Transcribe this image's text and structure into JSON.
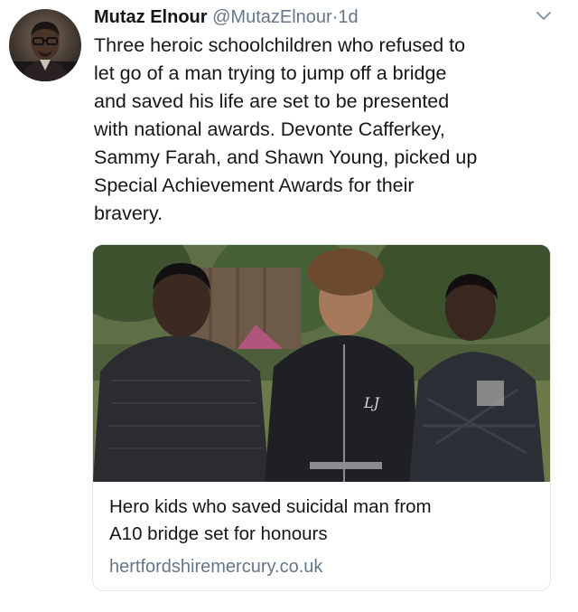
{
  "tweet": {
    "author_name": "Mutaz Elnour",
    "author_handle": "@MutazElnour",
    "separator": "·",
    "time": "1d",
    "text": "Three heroic schoolchildren who refused to\nlet go of a man trying to jump off a bridge\nand saved his life are set to be presented\nwith national awards. Devonte Cafferkey,\nSammy Farah, and Shawn Young, picked up\nSpecial Achievement Awards for their\nbravery."
  },
  "card": {
    "title": "Hero kids who saved suicidal man from\nA10 bridge set for honours",
    "domain": "hertfordshiremercury.co.uk",
    "image_alt": "Three boys standing in a garden"
  },
  "icons": {
    "menu": "chevron-down-icon"
  },
  "colors": {
    "name": "#14171a",
    "secondary": "#657786",
    "border": "#e1e8ed"
  }
}
